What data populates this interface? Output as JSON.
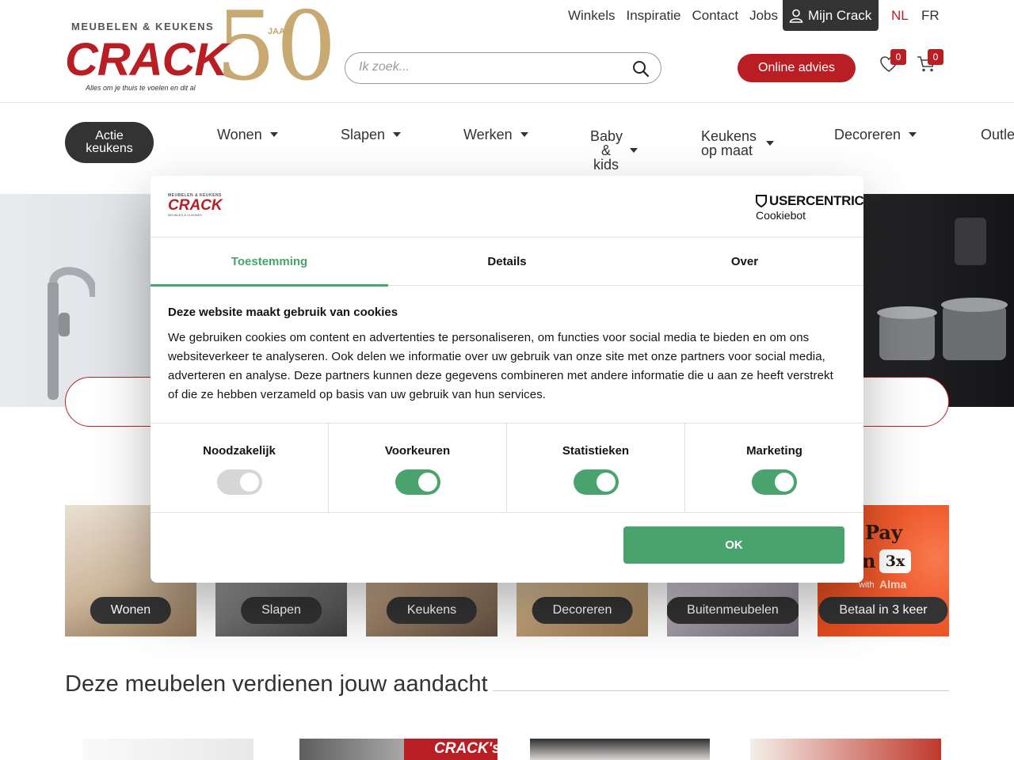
{
  "header": {
    "logo": {
      "tagline": "MEUBELEN & KEUKENS",
      "brand": "CRACK",
      "slogan": "Alles om je thuis te voelen en dit al",
      "anniversary_number": "50",
      "anniversary_label": "JAAR"
    },
    "top_links": [
      "Winkels",
      "Inspiratie",
      "Contact",
      "Jobs"
    ],
    "account_label": "Mijn Crack",
    "languages": {
      "nl": "NL",
      "fr": "FR",
      "active": "NL"
    },
    "search": {
      "placeholder": "Ik zoek..."
    },
    "advice_button": "Online advies",
    "wishlist_count": "0",
    "cart_count": "0",
    "colors": {
      "brand_red": "#b81e23",
      "gold": "#c5a56a",
      "dark": "#333333"
    }
  },
  "main_nav": {
    "promo": "Actie keukens",
    "items": [
      "Wonen",
      "Slapen",
      "Werken",
      "Baby & kids",
      "Keukens op maat",
      "Decoreren",
      "Outle"
    ]
  },
  "categories": [
    "Wonen",
    "Slapen",
    "Keukens",
    "Decoreren",
    "Buitenmeubelen",
    "Betaal in 3 keer"
  ],
  "payment_tile": {
    "line1": "Pay",
    "line2": "n",
    "badge": "3x",
    "with": "with",
    "provider": "Alma"
  },
  "section": {
    "title": "Deze meubelen verdienen jouw aandacht"
  },
  "product_badge": "CRACK's",
  "cookie_dialog": {
    "logo": {
      "tagline": "MEUBELEN & KEUKENS",
      "brand": "CRACK",
      "sub": "MEUBLES & CUISINES"
    },
    "provider": {
      "name": "USERCENTRICS",
      "product": "Cookiebot"
    },
    "tabs": [
      {
        "label": "Toestemming",
        "active": true
      },
      {
        "label": "Details",
        "active": false
      },
      {
        "label": "Over",
        "active": false
      }
    ],
    "heading": "Deze website maakt gebruik van cookies",
    "body": "We gebruiken cookies om content en advertenties te personaliseren, om functies voor social media te bieden en om ons websiteverkeer te analyseren. Ook delen we informatie over uw gebruik van onze site met onze partners voor social media, adverteren en analyse. Deze partners kunnen deze gegevens combineren met andere informatie die u aan ze heeft verstrekt of die ze hebben verzameld op basis van uw gebruik van hun services.",
    "categories": [
      {
        "label": "Noodzakelijk",
        "enabled": true,
        "locked": true
      },
      {
        "label": "Voorkeuren",
        "enabled": true,
        "locked": false
      },
      {
        "label": "Statistieken",
        "enabled": true,
        "locked": false
      },
      {
        "label": "Marketing",
        "enabled": true,
        "locked": false
      }
    ],
    "ok_button": "OK",
    "accent_color": "#48a36d"
  }
}
